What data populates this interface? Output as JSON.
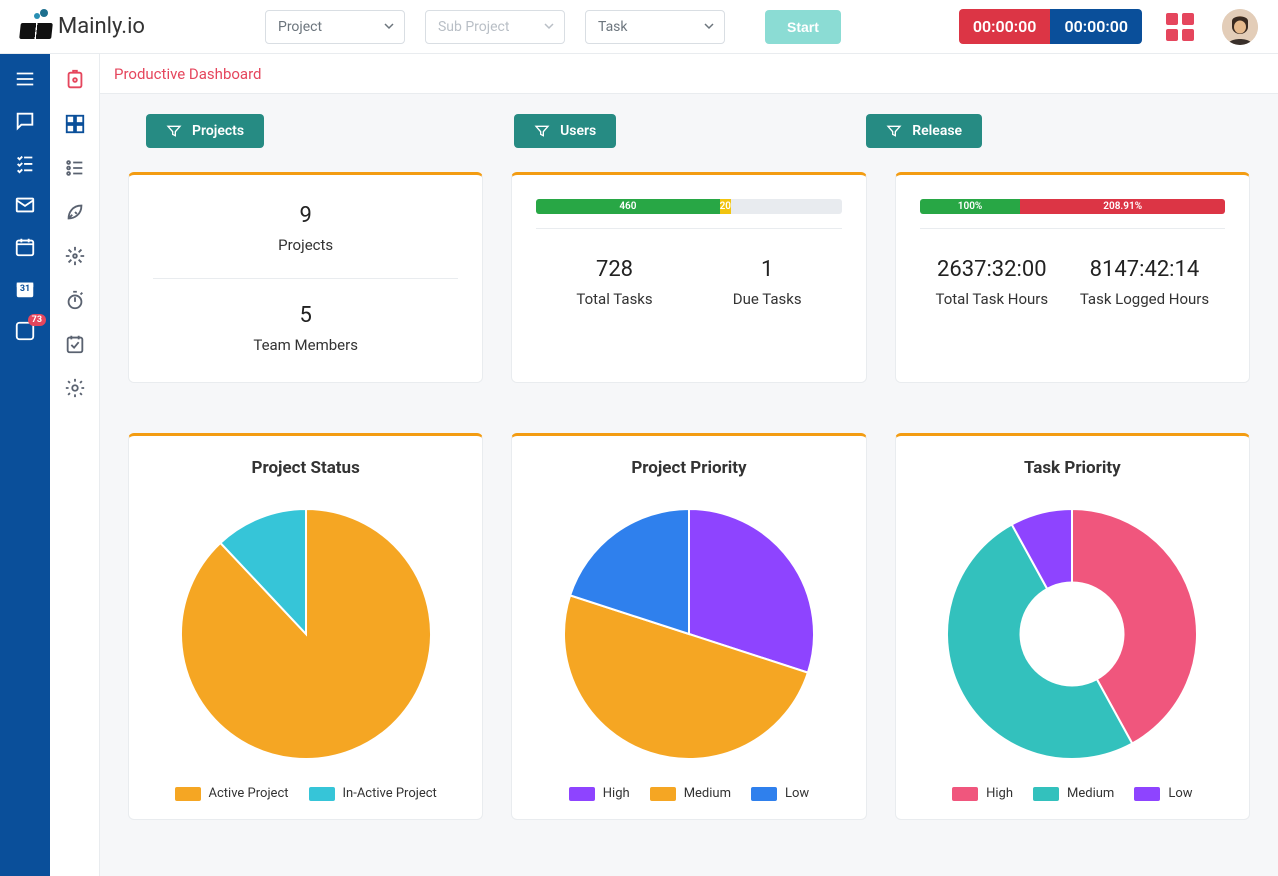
{
  "brand": "Mainly.io",
  "header": {
    "project_select": {
      "label": "Project"
    },
    "sub_project_select": {
      "label": "Sub Project"
    },
    "task_select": {
      "label": "Task"
    },
    "start_label": "Start",
    "timer_red": "00:00:00",
    "timer_blue": "00:00:00"
  },
  "rail": {
    "calendar_day": "31",
    "badge_count": "73"
  },
  "page_title": "Productive Dashboard",
  "filters": {
    "projects": "Projects",
    "users": "Users",
    "release": "Release"
  },
  "kpi_overview": {
    "projects_count": "9",
    "projects_label": "Projects",
    "team_count": "5",
    "team_label": "Team Members"
  },
  "kpi_tasks": {
    "bar_segments": [
      {
        "label": "460",
        "width_pct": 60,
        "color": "#28a745"
      },
      {
        "label": "20",
        "width_pct": 3.8,
        "color": "#f1c40f"
      }
    ],
    "total_tasks_value": "728",
    "total_tasks_label": "Total Tasks",
    "due_tasks_value": "1",
    "due_tasks_label": "Due Tasks"
  },
  "kpi_hours": {
    "bar_segments": [
      {
        "label": "100%",
        "width_pct": 33,
        "color": "#28a745"
      },
      {
        "label": "208.91%",
        "width_pct": 67,
        "color": "#dc3545"
      }
    ],
    "total_hours_value": "2637:32:00",
    "total_hours_label": "Total Task Hours",
    "logged_hours_value": "8147:42:14",
    "logged_hours_label": "Task Logged Hours"
  },
  "chart_data": [
    {
      "type": "pie",
      "title": "Project Status",
      "series": [
        {
          "name": "Active Project",
          "value": 88,
          "color": "#f5a623"
        },
        {
          "name": "In-Active Project",
          "value": 12,
          "color": "#36c5d8"
        }
      ]
    },
    {
      "type": "pie",
      "title": "Project Priority",
      "series": [
        {
          "name": "High",
          "value": 30,
          "color": "#8e44ff"
        },
        {
          "name": "Medium",
          "value": 50,
          "color": "#f5a623"
        },
        {
          "name": "Low",
          "value": 20,
          "color": "#2f80ed"
        }
      ]
    },
    {
      "type": "pie",
      "title": "Task Priority",
      "donut_inner_pct": 42,
      "series": [
        {
          "name": "High",
          "value": 42,
          "color": "#f0567d"
        },
        {
          "name": "Medium",
          "value": 50,
          "color": "#33c1bd"
        },
        {
          "name": "Low",
          "value": 8,
          "color": "#8e44ff"
        }
      ]
    }
  ]
}
